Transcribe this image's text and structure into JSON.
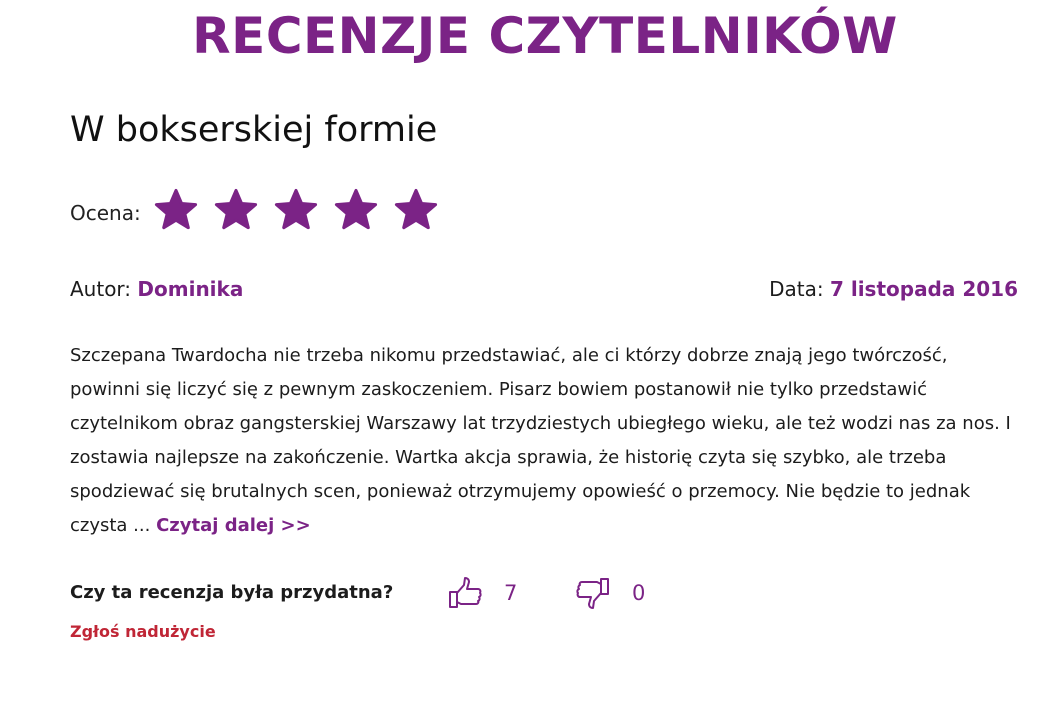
{
  "section": {
    "title": "RECENZJE CZYTELNIKÓW"
  },
  "review": {
    "title": "W bokserskiej formie",
    "rating_label": "Ocena:",
    "rating": 5,
    "rating_max": 5,
    "star_icon": "star-icon",
    "author_label": "Autor:",
    "author": "Dominika",
    "date_label": "Data:",
    "date": "7 listopada 2016",
    "excerpt": "Szczepana Twardocha nie trzeba nikomu przedstawiać, ale ci którzy dobrze znają jego twórczość, powinni się liczyć się z pewnym zaskoczeniem. Pisarz bowiem postanowił nie tylko przedstawić czytelnikom obraz gangsterskiej Warszawy lat trzydziestych ubiegłego wieku, ale też wodzi nas za nos. I zostawia najlepsze na zakończenie. Wartka akcja sprawia, że historię czyta się szybko, ale trzeba spodziewać się brutalnych scen, ponieważ otrzymujemy opowieść o przemocy. Nie będzie to jednak czysta ...",
    "read_more": "Czytaj dalej >>"
  },
  "feedback": {
    "question": "Czy ta recenzja była przydatna?",
    "thumbs_up_icon": "thumbs-up-icon",
    "thumbs_up_count": "7",
    "thumbs_down_icon": "thumbs-down-icon",
    "thumbs_down_count": "0",
    "report_label": "Zgłoś nadużycie"
  },
  "colors": {
    "accent": "#7b2386",
    "report": "#c02636",
    "text": "#1c1c1c"
  }
}
